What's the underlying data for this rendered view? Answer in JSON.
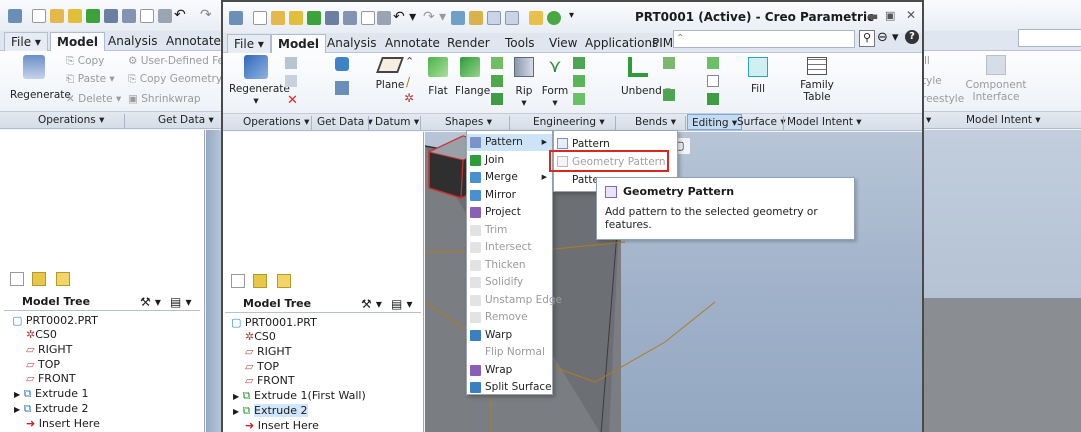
{
  "left_window": {
    "tabs": [
      "File",
      "Model",
      "Analysis",
      "Annotate"
    ],
    "ribbon": {
      "regenerate": "Regenerate",
      "copy": "Copy",
      "paste": "Paste",
      "delete": "Delete",
      "user_defined": "User-Defined Feat",
      "copy_geometry": "Copy Geometry",
      "shrinkwrap": "Shrinkwrap"
    },
    "groups": [
      "Operations",
      "Get Data"
    ],
    "tree_header": "Model Tree",
    "tree": [
      "PRT0002.PRT",
      "CS0",
      "RIGHT",
      "TOP",
      "FRONT",
      "Extrude 1",
      "Extrude 2",
      "Insert Here"
    ]
  },
  "main_window": {
    "title": "PRT0001 (Active) - Creo Parametric",
    "tabs": [
      "File",
      "Model",
      "Analysis",
      "Annotate",
      "Render",
      "Tools",
      "View",
      "Applications",
      "PIM"
    ],
    "ribbon": {
      "regenerate": "Regenerate",
      "plane": "Plane",
      "flat": "Flat",
      "flange": "Flange",
      "rip": "Rip",
      "form": "Form",
      "unbend": "Unbend",
      "fill": "Fill",
      "family_table": "Family Table"
    },
    "groups": [
      "Operations",
      "Get Data",
      "Datum",
      "Shapes",
      "Engineering",
      "Bends",
      "Editing",
      "Surface",
      "Model Intent"
    ],
    "tree_header": "Model Tree",
    "tree": [
      "PRT0001.PRT",
      "CS0",
      "RIGHT",
      "TOP",
      "FRONT",
      "Extrude 1(First Wall)",
      "Extrude 2",
      "Insert Here"
    ]
  },
  "editing_menu": {
    "items": [
      {
        "label": "Pattern",
        "enabled": true,
        "submenu": true,
        "highlight": true
      },
      {
        "label": "Join",
        "enabled": true
      },
      {
        "label": "Merge",
        "enabled": true,
        "submenu": true
      },
      {
        "label": "Mirror",
        "enabled": true
      },
      {
        "label": "Project",
        "enabled": true
      },
      {
        "label": "Trim",
        "enabled": false
      },
      {
        "label": "Intersect",
        "enabled": false
      },
      {
        "label": "Thicken",
        "enabled": false
      },
      {
        "label": "Solidify",
        "enabled": false
      },
      {
        "label": "Unstamp Edge",
        "enabled": false
      },
      {
        "label": "Remove",
        "enabled": false
      },
      {
        "label": "Warp",
        "enabled": true
      },
      {
        "label": "Flip Normal",
        "enabled": false
      },
      {
        "label": "Wrap",
        "enabled": true
      },
      {
        "label": "Split Surface",
        "enabled": true
      }
    ]
  },
  "pattern_submenu": {
    "items": [
      "Pattern",
      "Geometry Pattern",
      "Patte"
    ]
  },
  "tooltip": {
    "title": "Geometry Pattern",
    "description": "Add pattern to the selected geometry or features."
  },
  "right_window": {
    "ribbon": {
      "style": "tyle",
      "freestyle": "reestyle",
      "component_interface": "Component Interface"
    },
    "groups": [
      "Model Intent"
    ]
  },
  "colors": {
    "highlight": "#cde3f7",
    "callout_red": "#d9281f",
    "viewport_bg": "#a8b9cf"
  }
}
